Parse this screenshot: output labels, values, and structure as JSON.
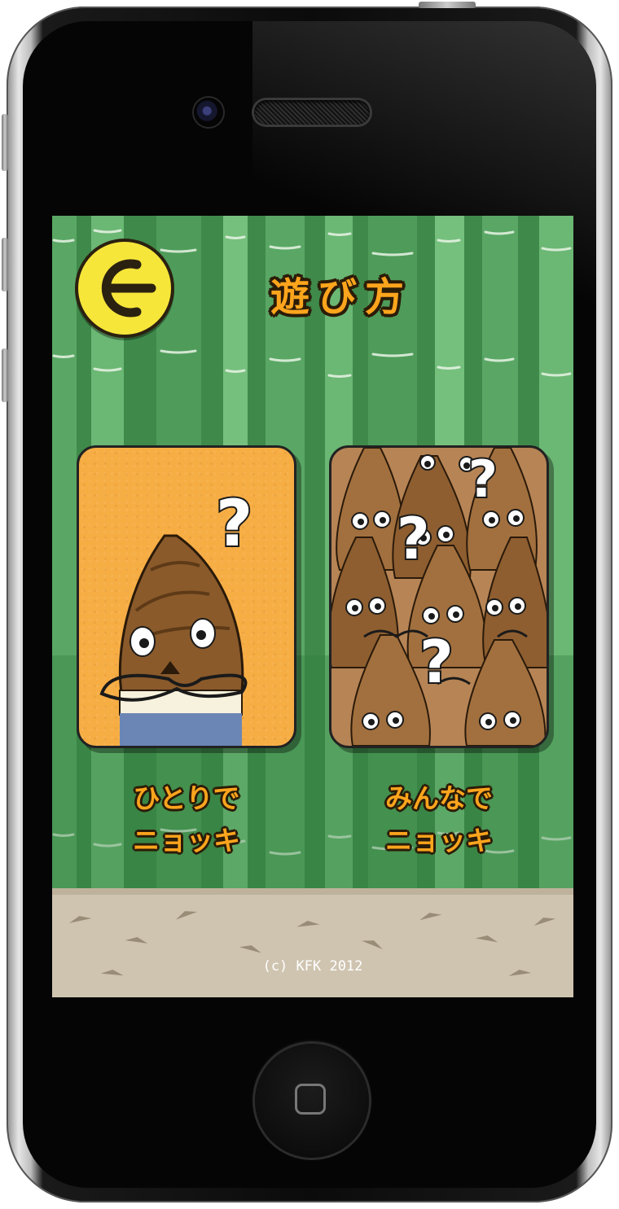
{
  "screen": {
    "title": "遊び方",
    "back_icon": "left-arrow-icon",
    "modes": [
      {
        "line1": "ひとりで",
        "line2": "ニョッキ"
      },
      {
        "line1": "みんなで",
        "line2": "ニョッキ"
      }
    ],
    "copyright": "(c) KFK 2012"
  },
  "colors": {
    "bamboo_light": "#63b06c",
    "bamboo_dark": "#3f8a4a",
    "title_orange": "#ffa51d",
    "back_button_yellow": "#f7e63a",
    "card_orange": "#f6ad44",
    "ground": "#cfc4b0"
  }
}
